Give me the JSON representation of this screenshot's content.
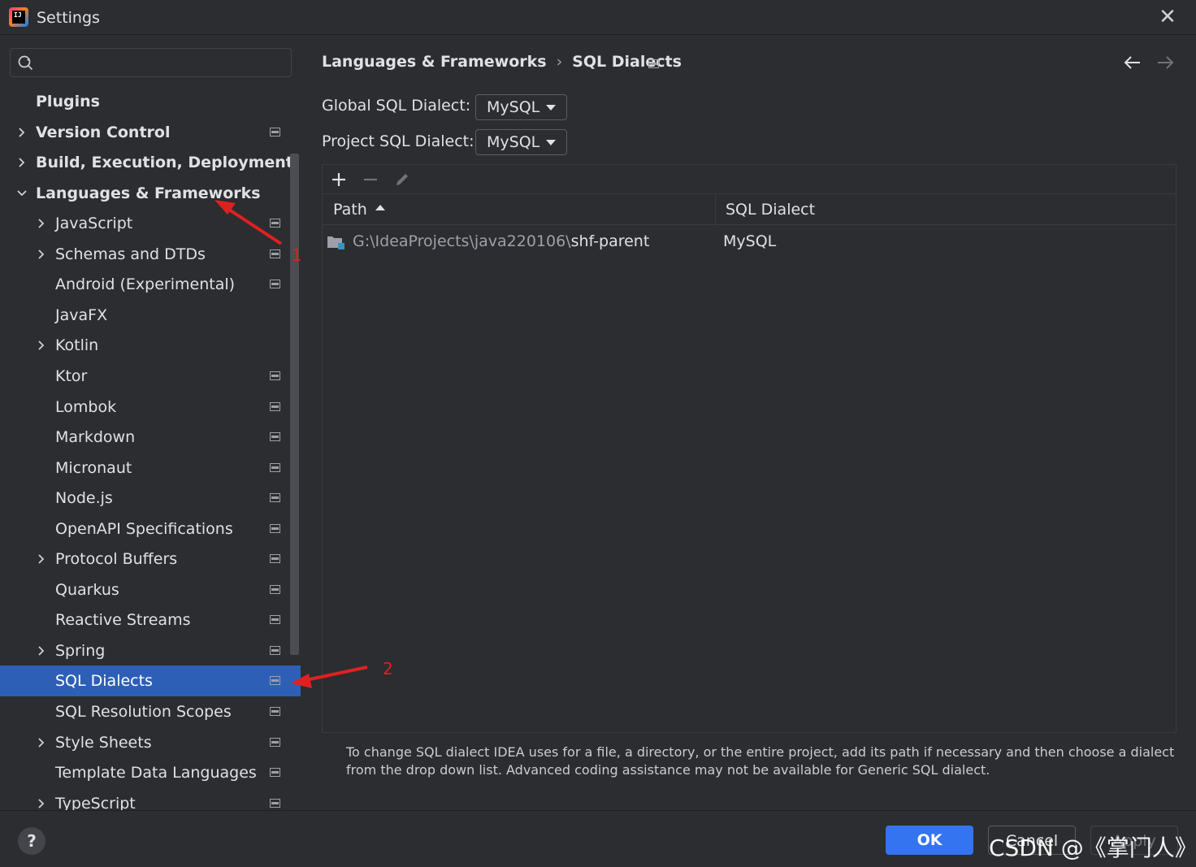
{
  "window": {
    "title": "Settings",
    "close_glyph": "✕"
  },
  "search": {
    "placeholder": "",
    "icon": "search-icon"
  },
  "sidebar": {
    "items": [
      {
        "label": "Plugins",
        "level": 0,
        "bold": true,
        "expandable": false,
        "project_icon": false
      },
      {
        "label": "Version Control",
        "level": 0,
        "bold": true,
        "expandable": true,
        "expanded": false,
        "project_icon": true
      },
      {
        "label": "Build, Execution, Deployment",
        "level": 0,
        "bold": true,
        "expandable": true,
        "expanded": false,
        "project_icon": false
      },
      {
        "label": "Languages & Frameworks",
        "level": 0,
        "bold": true,
        "expandable": true,
        "expanded": true,
        "project_icon": false
      },
      {
        "label": "JavaScript",
        "level": 1,
        "expandable": true,
        "expanded": false,
        "project_icon": true
      },
      {
        "label": "Schemas and DTDs",
        "level": 1,
        "expandable": true,
        "expanded": false,
        "project_icon": true
      },
      {
        "label": "Android (Experimental)",
        "level": 1,
        "expandable": false,
        "project_icon": true
      },
      {
        "label": "JavaFX",
        "level": 1,
        "expandable": false,
        "project_icon": false
      },
      {
        "label": "Kotlin",
        "level": 1,
        "expandable": true,
        "expanded": false,
        "project_icon": false
      },
      {
        "label": "Ktor",
        "level": 1,
        "expandable": false,
        "project_icon": true
      },
      {
        "label": "Lombok",
        "level": 1,
        "expandable": false,
        "project_icon": true
      },
      {
        "label": "Markdown",
        "level": 1,
        "expandable": false,
        "project_icon": true
      },
      {
        "label": "Micronaut",
        "level": 1,
        "expandable": false,
        "project_icon": true
      },
      {
        "label": "Node.js",
        "level": 1,
        "expandable": false,
        "project_icon": true
      },
      {
        "label": "OpenAPI Specifications",
        "level": 1,
        "expandable": false,
        "project_icon": true
      },
      {
        "label": "Protocol Buffers",
        "level": 1,
        "expandable": true,
        "expanded": false,
        "project_icon": true
      },
      {
        "label": "Quarkus",
        "level": 1,
        "expandable": false,
        "project_icon": true
      },
      {
        "label": "Reactive Streams",
        "level": 1,
        "expandable": false,
        "project_icon": true
      },
      {
        "label": "Spring",
        "level": 1,
        "expandable": true,
        "expanded": false,
        "project_icon": true
      },
      {
        "label": "SQL Dialects",
        "level": 1,
        "expandable": false,
        "project_icon": true,
        "selected": true
      },
      {
        "label": "SQL Resolution Scopes",
        "level": 1,
        "expandable": false,
        "project_icon": true
      },
      {
        "label": "Style Sheets",
        "level": 1,
        "expandable": true,
        "expanded": false,
        "project_icon": true
      },
      {
        "label": "Template Data Languages",
        "level": 1,
        "expandable": false,
        "project_icon": true
      },
      {
        "label": "TypeScript",
        "level": 1,
        "expandable": true,
        "expanded": false,
        "project_icon": true
      }
    ]
  },
  "main": {
    "breadcrumb": {
      "parent": "Languages & Frameworks",
      "separator": "›",
      "current": "SQL Dialects"
    },
    "global_dialect": {
      "label": "Global SQL Dialect:",
      "value": "MySQL"
    },
    "project_dialect": {
      "label": "Project SQL Dialect:",
      "value": "MySQL"
    },
    "toolbar": {
      "add": "add-icon",
      "remove": "remove-icon",
      "edit": "edit-icon"
    },
    "table": {
      "columns": [
        "Path",
        "SQL Dialect"
      ],
      "rows": [
        {
          "path_prefix": "G:\\IdeaProjects\\java220106\\",
          "path_name": "shf-parent",
          "dialect": "MySQL"
        }
      ]
    },
    "help_text": "To change SQL dialect IDEA uses for a file, a directory, or the entire project, add its path if necessary and then choose a dialect from the drop down list. Advanced coding assistance may not be available for Generic SQL dialect."
  },
  "footer": {
    "help": "?",
    "ok": "OK",
    "cancel": "Cancel",
    "apply": "Apply",
    "watermark": "CSDN @《掌门人》"
  },
  "annotations": {
    "arrow1_number": "1",
    "arrow2_number": "2",
    "color": "#e02020"
  },
  "colors": {
    "background": "#2b2d30",
    "selection": "#2e5fb7",
    "primary_button": "#3574f0",
    "text": "#dfe1e5"
  }
}
